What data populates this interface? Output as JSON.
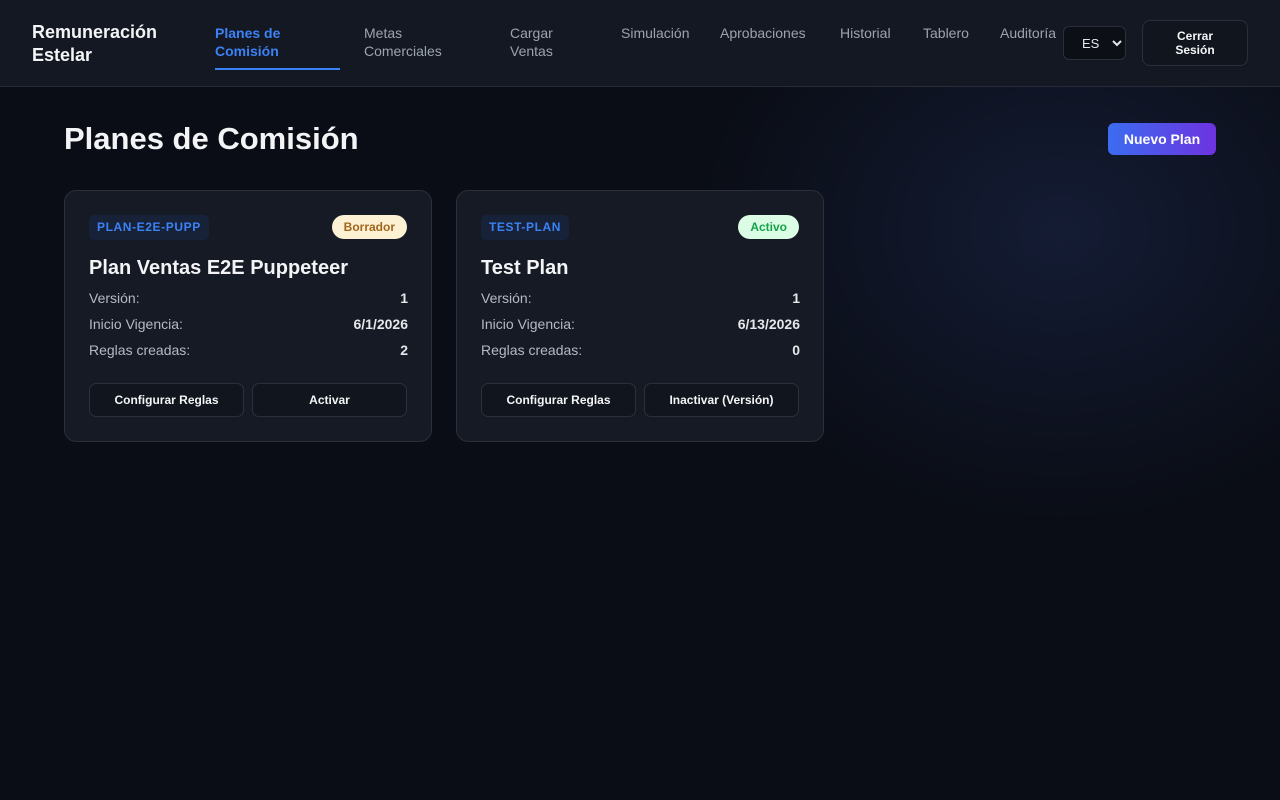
{
  "app": {
    "brand": "Remuneración Estelar"
  },
  "nav": {
    "items": [
      {
        "label": "Planes de Comisión",
        "active": true
      },
      {
        "label": "Metas Comerciales",
        "active": false
      },
      {
        "label": "Cargar Ventas",
        "active": false
      },
      {
        "label": "Simulación",
        "active": false
      },
      {
        "label": "Aprobaciones",
        "active": false
      },
      {
        "label": "Historial",
        "active": false
      },
      {
        "label": "Tablero",
        "active": false
      },
      {
        "label": "Auditoría",
        "active": false
      }
    ],
    "language": {
      "selected": "ES"
    },
    "logout_label": "Cerrar Sesión"
  },
  "page": {
    "title": "Planes de Comisión",
    "new_plan_label": "Nuevo Plan"
  },
  "labels": {
    "version": "Versión:",
    "start": "Inicio Vigencia:",
    "rules": "Reglas creadas:"
  },
  "plans": [
    {
      "code": "PLAN-E2E-PUPP",
      "status": "Borrador",
      "name": "Plan Ventas E2E Puppeteer",
      "version": "1",
      "start_date": "6/1/2026",
      "rules_created": "2",
      "actions": [
        "Configurar Reglas",
        "Activar"
      ]
    },
    {
      "code": "TEST-PLAN",
      "status": "Activo",
      "name": "Test Plan",
      "version": "1",
      "start_date": "6/13/2026",
      "rules_created": "0",
      "actions": [
        "Configurar Reglas",
        "Inactivar (Versión)"
      ]
    }
  ],
  "colors": {
    "accent": "#3b82f6",
    "background": "#0a0d15",
    "card": "#161a24",
    "status_draft_bg": "#fdf1d4",
    "status_draft_fg": "#a1661b",
    "status_active_bg": "#dbfde5",
    "status_active_fg": "#16a34a",
    "primary_gradient_start": "#3b6cf0",
    "primary_gradient_end": "#6d33e0"
  }
}
